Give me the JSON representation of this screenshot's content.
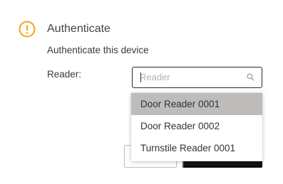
{
  "dialog": {
    "title": "Authenticate",
    "subtitle": "Authenticate this device",
    "icon": "warning-circle-icon",
    "accent_color": "#f0a51c"
  },
  "reader": {
    "label": "Reader:",
    "search": {
      "value": "",
      "placeholder": "Reader",
      "icon": "search-icon"
    },
    "options": [
      {
        "label": "Door Reader 0001",
        "highlighted": true
      },
      {
        "label": "Door Reader 0002",
        "highlighted": false
      },
      {
        "label": "Turnstile Reader 0001",
        "highlighted": false
      }
    ]
  },
  "actions": {
    "secondary_label": "",
    "primary_label": ""
  },
  "colors": {
    "highlight": "#bdbcbb",
    "primary_button": "#141414",
    "input_border": "#2a2a2a"
  }
}
